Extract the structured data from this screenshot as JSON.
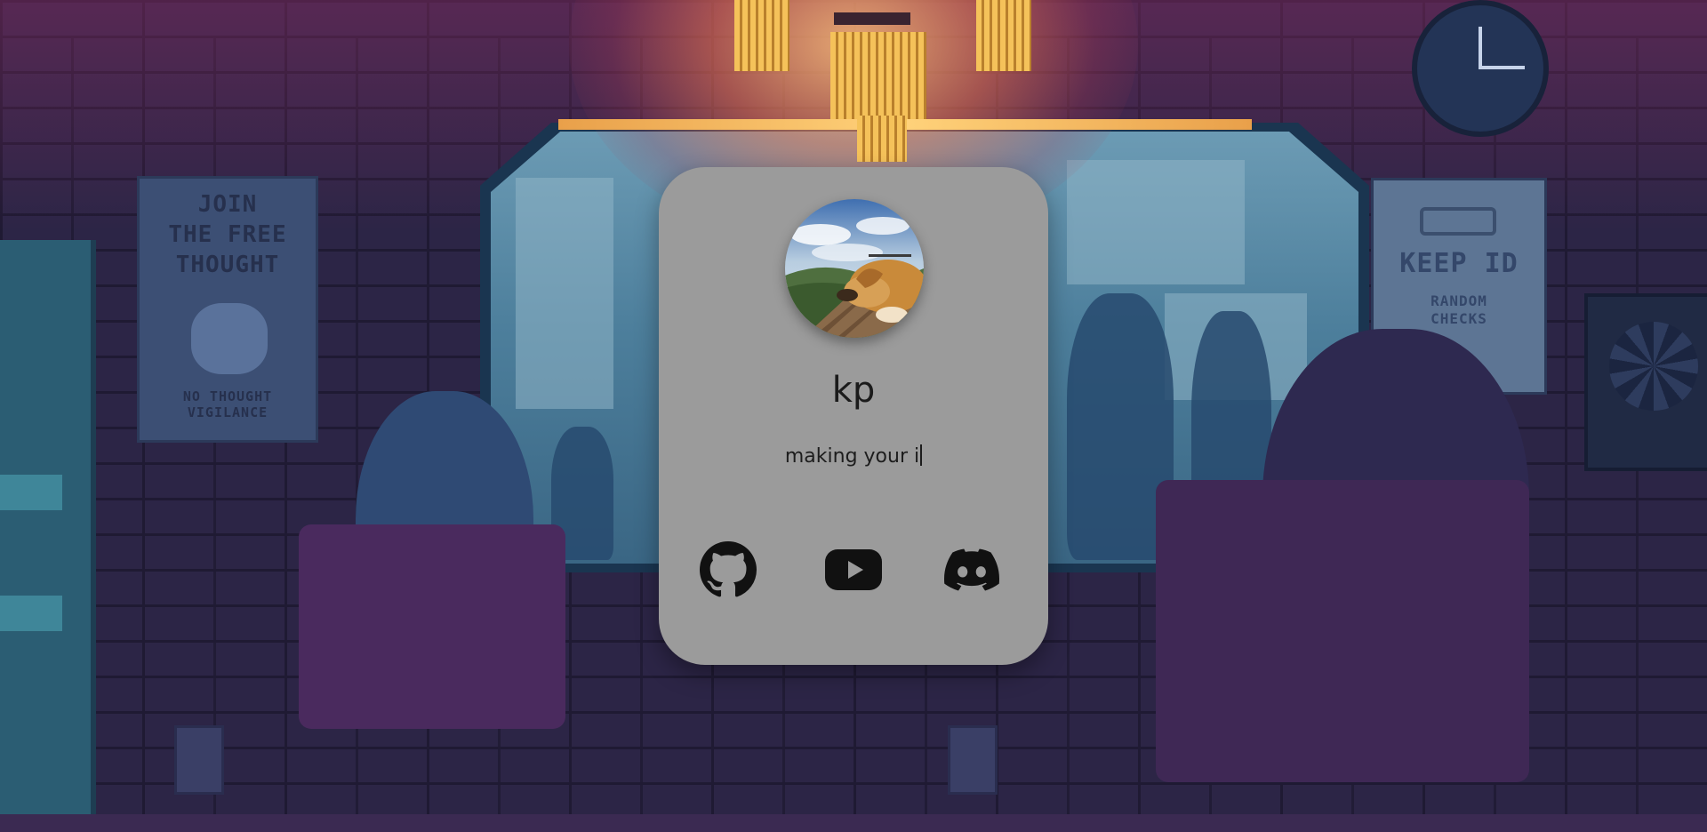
{
  "profile": {
    "name": "kp",
    "tagline": "making your i"
  },
  "avatar": {
    "icon": "dog-photo"
  },
  "social": [
    {
      "name": "github",
      "icon": "github-icon"
    },
    {
      "name": "youtube",
      "icon": "youtube-icon"
    },
    {
      "name": "discord",
      "icon": "discord-icon"
    }
  ],
  "background": {
    "poster_left": {
      "headline": [
        "JOIN",
        "THE FREE",
        "THOUGHT"
      ],
      "footer": [
        "NO THOUGHT",
        "VIGILANCE"
      ]
    },
    "poster_right": {
      "headline": "KEEP ID",
      "footer": [
        "RANDOM",
        "CHECKS"
      ]
    }
  },
  "colors": {
    "card": "#9b9b9b",
    "text": "#1b1b1b",
    "icon": "#111111"
  }
}
